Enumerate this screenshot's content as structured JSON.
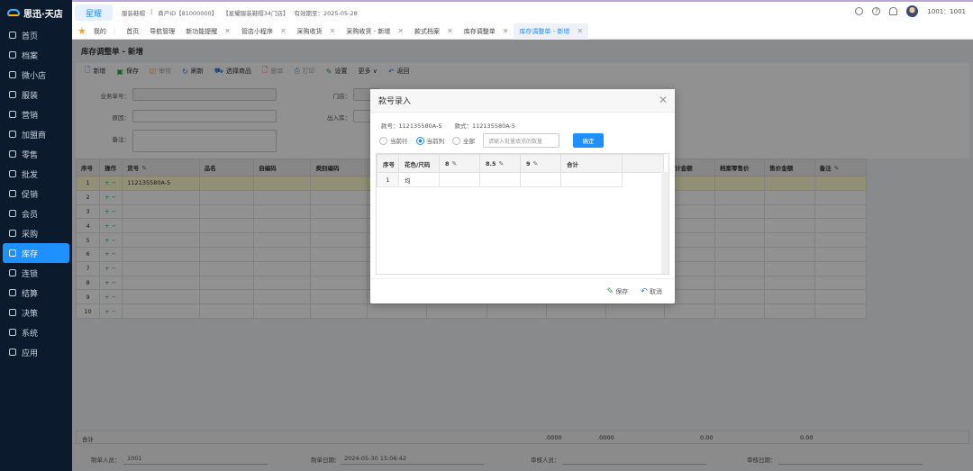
{
  "app": {
    "logo": "思迅·天店"
  },
  "sidebar": {
    "items": [
      {
        "label": "首页"
      },
      {
        "label": "档案"
      },
      {
        "label": "微小店"
      },
      {
        "label": "服装"
      },
      {
        "label": "营销"
      },
      {
        "label": "加盟商"
      },
      {
        "label": "零售"
      },
      {
        "label": "批发"
      },
      {
        "label": "促销"
      },
      {
        "label": "会员"
      },
      {
        "label": "采购"
      },
      {
        "label": "库存",
        "active": true
      },
      {
        "label": "连锁"
      },
      {
        "label": "结算"
      },
      {
        "label": "决策"
      },
      {
        "label": "系统"
      },
      {
        "label": "应用"
      }
    ]
  },
  "topbar": {
    "brand": "星耀",
    "industry": "服装鞋帽",
    "merchant_id": "商户ID【81000000】",
    "store": "【星耀服装鞋帽34门店】",
    "expiry": "有效期至：2025-05-28",
    "user": "1001：1001"
  },
  "tabs": {
    "favorites": "我的",
    "items": [
      {
        "label": "首页"
      },
      {
        "label": "导航管理"
      },
      {
        "label": "新功能提醒",
        "closable": true
      },
      {
        "label": "管店小程序",
        "closable": true
      },
      {
        "label": "采购收货",
        "closable": true
      },
      {
        "label": "采购收货 - 新增",
        "closable": true
      },
      {
        "label": "款式档案",
        "closable": true
      },
      {
        "label": "库存调整单",
        "closable": true
      },
      {
        "label": "库存调整单 - 新增",
        "closable": true,
        "active": true
      }
    ]
  },
  "page": {
    "title": "库存调整单 - 新增",
    "toolbar": [
      {
        "label": "新增",
        "icon": "doc-icon",
        "color": "#3c7bd6"
      },
      {
        "label": "保存",
        "icon": "save-icon",
        "color": "#2e9b4a"
      },
      {
        "label": "审核",
        "icon": "check-icon",
        "color": "#e8834a",
        "disabled": true
      },
      {
        "label": "刷新",
        "icon": "refresh-icon",
        "color": "#3c7bd6"
      },
      {
        "label": "选择商品",
        "icon": "cart-icon",
        "color": "#3c7bd6"
      },
      {
        "label": "删单",
        "icon": "delete-doc-icon",
        "color": "#e0503c",
        "disabled": true
      },
      {
        "label": "打印",
        "icon": "print-icon",
        "color": "#6aa0c8",
        "disabled": true
      },
      {
        "label": "设置",
        "icon": "edit-icon",
        "color": "#2e9b4a"
      },
      {
        "label": "更多 ∨",
        "icon": "",
        "color": "#333"
      },
      {
        "label": "返回",
        "icon": "back-icon",
        "color": "#3c7bd6"
      }
    ],
    "form": {
      "doc_no": "业务单号：",
      "reason": "原因：",
      "remark": "备注：",
      "store": "门店：",
      "io": "出入库："
    },
    "grid": {
      "headers": [
        "序号",
        "操作",
        "货号",
        "品名",
        "自编码",
        "类别编码",
        "",
        "",
        "",
        "",
        "",
        "合计金额",
        "档案零售价",
        "售价金额",
        "备注"
      ],
      "rows": [
        {
          "no": "1",
          "code": "112135580A-5"
        },
        {
          "no": "2",
          "code": ""
        },
        {
          "no": "3",
          "code": ""
        },
        {
          "no": "4",
          "code": ""
        },
        {
          "no": "5",
          "code": ""
        },
        {
          "no": "6",
          "code": ""
        },
        {
          "no": "7",
          "code": ""
        },
        {
          "no": "8",
          "code": ""
        },
        {
          "no": "9",
          "code": ""
        },
        {
          "no": "10",
          "code": ""
        }
      ],
      "ops": "+ −"
    },
    "totals": {
      "label": "合计",
      "qty1": ".0000",
      "qty2": ".0000",
      "amt1": "0.00",
      "amt2": "0.00"
    },
    "footer": {
      "creator_label": "制单人员：",
      "creator": "1001",
      "date_label": "制单日期：",
      "date": "2024-05-30 15:06:42",
      "auditor_label": "审核人员：",
      "audit_date_label": "审核日期："
    }
  },
  "modal": {
    "title": "款号录入",
    "style_no": "款号：112135580A-5",
    "style": "款式：112135580A-5",
    "radios": [
      {
        "label": "当前行",
        "checked": false
      },
      {
        "label": "当前列",
        "checked": true
      },
      {
        "label": "全部",
        "checked": false
      }
    ],
    "batch_placeholder": "请输入批量填充的数量",
    "confirm": "确定",
    "headers": [
      "序号",
      "花色/尺码",
      "8",
      "8.5",
      "9",
      "合计"
    ],
    "rows": [
      {
        "no": "1",
        "color": "均"
      }
    ],
    "save": "保存",
    "cancel": "取消"
  }
}
